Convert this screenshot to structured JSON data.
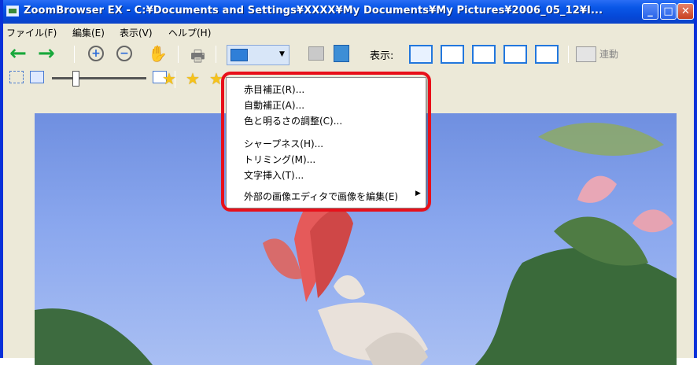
{
  "window": {
    "title": "ZoomBrowser EX - C:¥Documents and Settings¥XXXX¥My Documents¥My Pictures¥2006_05_12¥I..."
  },
  "menubar": {
    "items": [
      "ファイル(F)",
      "編集(E)",
      "表示(V)",
      "ヘルプ(H)"
    ]
  },
  "toolbar": {
    "view_label": "表示:",
    "link_label": "連動"
  },
  "dropdown": {
    "items": [
      "赤目補正(R)...",
      "自動補正(A)...",
      "色と明るさの調整(C)...",
      "シャープネス(H)...",
      "トリミング(M)...",
      "文字挿入(T)...",
      "外部の画像エディタで画像を編集(E)"
    ]
  },
  "colors": {
    "highlight": "#e8101a",
    "titlebar": "#0a58e8",
    "arrow": "#18a83b"
  }
}
